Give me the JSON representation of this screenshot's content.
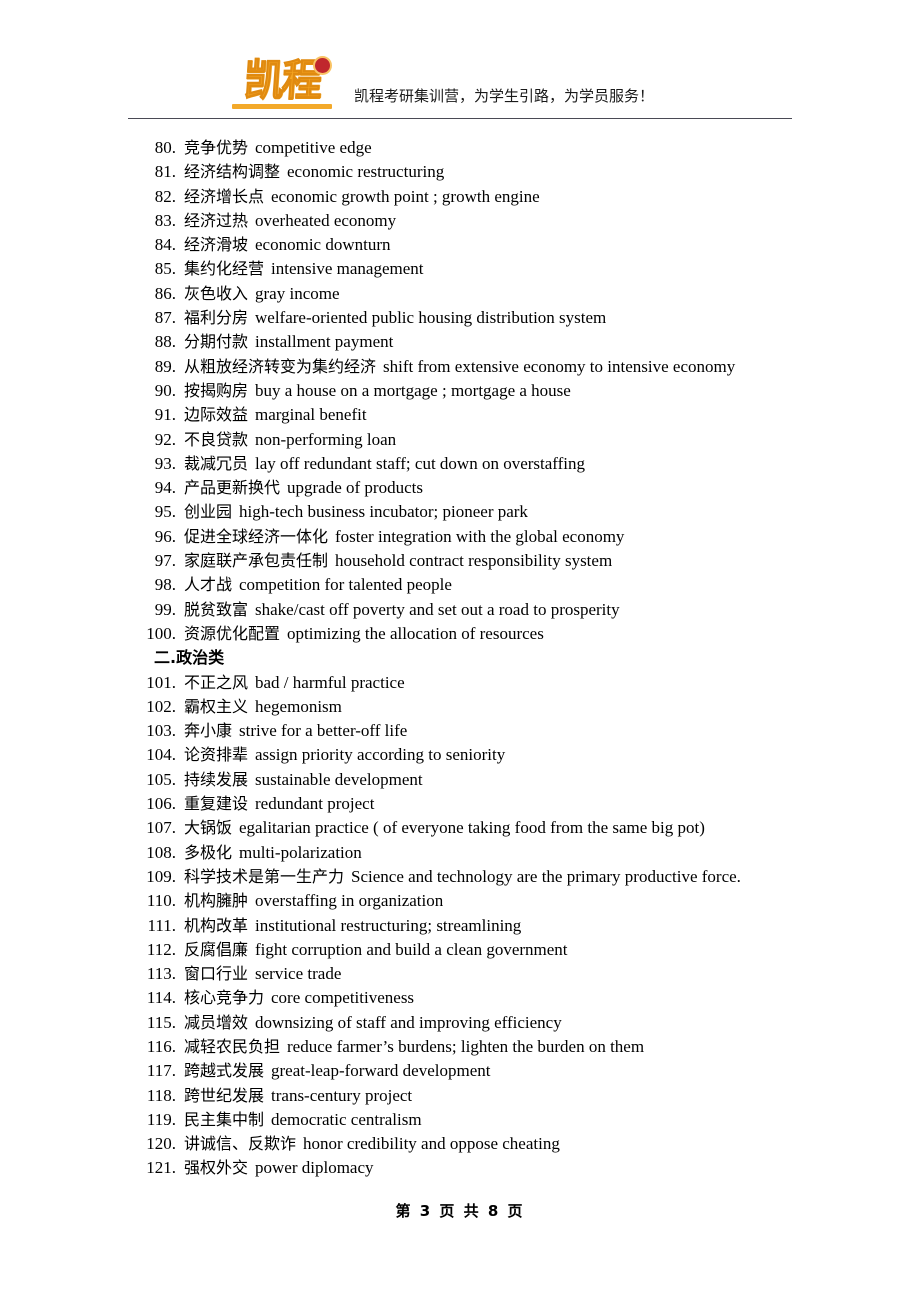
{
  "header": {
    "logo_text": "凯程",
    "logo_icon": "kaicheng-logo-icon",
    "slogan": "凯程考研集训营，为学生引路，为学员服务！"
  },
  "footer": {
    "page_label": "第 3 页 共 8 页",
    "current_page": "3",
    "total_pages": "8"
  },
  "content": {
    "entries": [
      {
        "num": "80.",
        "cn": "竞争优势",
        "en": "competitive edge"
      },
      {
        "num": "81.",
        "cn": "经济结构调整",
        "en": "economic restructuring"
      },
      {
        "num": "82.",
        "cn": "经济增长点",
        "en": "economic growth point ; growth engine"
      },
      {
        "num": "83.",
        "cn": "经济过热",
        "en": "overheated economy"
      },
      {
        "num": "84.",
        "cn": "经济滑坡",
        "en": "economic downturn"
      },
      {
        "num": "85.",
        "cn": "集约化经营",
        "en": "intensive management"
      },
      {
        "num": "86.",
        "cn": "灰色收入",
        "en": "gray income"
      },
      {
        "num": "87.",
        "cn": "福利分房",
        "en": "welfare-oriented public housing distribution system"
      },
      {
        "num": "88.",
        "cn": "分期付款",
        "en": "installment payment"
      },
      {
        "num": "89.",
        "cn": "从粗放经济转变为集约经济",
        "en": "shift from extensive economy to intensive economy"
      },
      {
        "num": "90.",
        "cn": "按揭购房",
        "en": "buy a house on a mortgage ; mortgage a house"
      },
      {
        "num": "91.",
        "cn": "边际效益",
        "en": "marginal benefit"
      },
      {
        "num": "92.",
        "cn": "不良贷款",
        "en": "non-performing loan"
      },
      {
        "num": "93.",
        "cn": "裁减冗员",
        "en": "lay off redundant staff; cut down on overstaffing"
      },
      {
        "num": "94.",
        "cn": "产品更新换代",
        "en": "upgrade of products"
      },
      {
        "num": "95.",
        "cn": "创业园",
        "en": "high-tech business incubator; pioneer park"
      },
      {
        "num": "96.",
        "cn": "促进全球经济一体化",
        "en": "foster integration with the global economy"
      },
      {
        "num": "97.",
        "cn": "家庭联产承包责任制",
        "en": "household contract responsibility system"
      },
      {
        "num": "98.",
        "cn": "人才战",
        "en": "competition for talented people"
      },
      {
        "num": "99.",
        "cn": "脱贫致富",
        "en": "shake/cast off poverty and set out a road to prosperity"
      },
      {
        "num": "100.",
        "cn": "资源优化配置",
        "en": "optimizing the allocation of resources"
      },
      {
        "section": "二.政治类"
      },
      {
        "num": "101.",
        "cn": "不正之风",
        "en": "bad / harmful practice"
      },
      {
        "num": "102.",
        "cn": "霸权主义",
        "en": "hegemonism"
      },
      {
        "num": "103.",
        "cn": "奔小康",
        "en": "strive for a better-off life"
      },
      {
        "num": "104.",
        "cn": "论资排辈",
        "en": "assign priority according to seniority"
      },
      {
        "num": "105.",
        "cn": "持续发展",
        "en": "sustainable development"
      },
      {
        "num": "106.",
        "cn": "重复建设",
        "en": "redundant project"
      },
      {
        "num": "107.",
        "cn": "大锅饭",
        "en": "egalitarian practice ( of everyone taking food from the same big pot)"
      },
      {
        "num": "108.",
        "cn": "多极化",
        "en": "multi-polarization"
      },
      {
        "num": "109.",
        "cn": "科学技术是第一生产力",
        "en": "Science and technology are the primary productive force."
      },
      {
        "num": "110.",
        "cn": "机构臃肿",
        "en": "overstaffing in organization"
      },
      {
        "num": "111.",
        "cn": "机构改革",
        "en": "institutional restructuring; streamlining"
      },
      {
        "num": "112.",
        "cn": "反腐倡廉",
        "en": "fight corruption and build a clean government"
      },
      {
        "num": "113.",
        "cn": "窗口行业",
        "en": "service trade"
      },
      {
        "num": "114.",
        "cn": "核心竞争力",
        "en": "core competitiveness"
      },
      {
        "num": "115.",
        "cn": "减员增效",
        "en": "downsizing of staff and improving efficiency"
      },
      {
        "num": "116.",
        "cn": "减轻农民负担",
        "en": "reduce farmer’s burdens; lighten the burden on them"
      },
      {
        "num": "117.",
        "cn": "跨越式发展",
        "en": "great-leap-forward development"
      },
      {
        "num": "118.",
        "cn": "跨世纪发展",
        "en": "trans-century project"
      },
      {
        "num": "119.",
        "cn": "民主集中制",
        "en": "democratic centralism"
      },
      {
        "num": "120.",
        "cn": "讲诚信、反欺诈",
        "en": "honor credibility and oppose cheating"
      },
      {
        "num": "121.",
        "cn": "强权外交",
        "en": "power diplomacy"
      }
    ]
  }
}
